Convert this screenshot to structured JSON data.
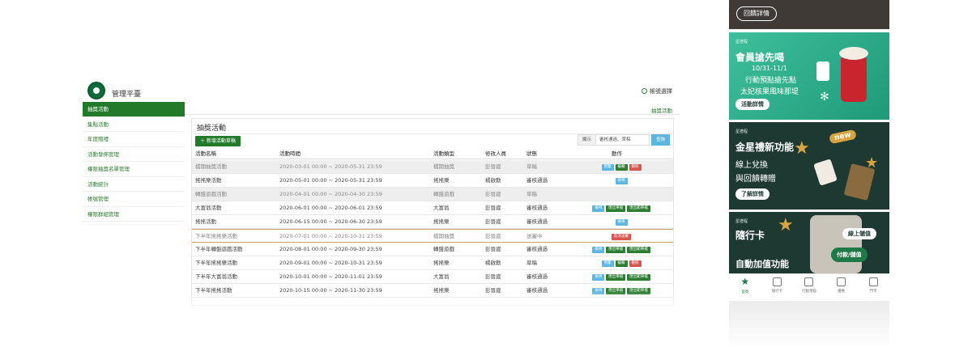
{
  "admin": {
    "brand": "管理平臺",
    "account": "帳號選擇",
    "breadcrumb": "抽獎活動",
    "sidebar": [
      "抽獎活動",
      "集點活動",
      "年度贈禮",
      "活動發佈管理",
      "權限抽獎名單管理",
      "活動統計",
      "帳號管理",
      "權限群組管理"
    ],
    "panel_title": "抽獎活動",
    "add_button": "＋ 新增活動草稿",
    "filter": {
      "label": "顯示",
      "value": "審核通過、草稿",
      "go": "查詢"
    },
    "columns": [
      "活動名稱",
      "活動時間",
      "活動類型",
      "修改人員",
      "狀態",
      "動作"
    ],
    "rows": [
      {
        "name": "檔期抽獎活動",
        "time": "2020-03-01 00:00 ~ 2020-05-31 23:59",
        "type": "檔期抽獎",
        "user": "彭晉崴",
        "state": "草稿",
        "actions": [
          [
            "預覽",
            "blue"
          ],
          [
            "編輯",
            "green"
          ],
          [
            "刪除",
            "red"
          ]
        ]
      },
      {
        "name": "搖搖樂活動",
        "time": "2020-05-01 00:00 ~ 2020-05-31 23:59",
        "type": "搖搖樂",
        "user": "楊啟勳",
        "state": "審核通過",
        "actions": [
          [
            "檢視",
            "blue"
          ]
        ]
      },
      {
        "name": "轉盤遊戲活動",
        "time": "2020-04-01 00:00 ~ 2020-04-30 23:59",
        "type": "轉盤遊戲",
        "user": "彭晉崴",
        "state": "草稿",
        "actions": []
      },
      {
        "name": "大富翁活動",
        "time": "2020-06-01 00:00 ~ 2020-06-01 23:59",
        "type": "大富翁",
        "user": "彭晉崴",
        "state": "審核通過",
        "actions": [
          [
            "檢視",
            "blue"
          ],
          [
            "匯出單檔",
            "green"
          ],
          [
            "匯出範單檔",
            "green"
          ]
        ]
      },
      {
        "name": "搖搖活動",
        "time": "2020-06-15 00:00 ~ 2020-06-30 23:59",
        "type": "搖搖樂",
        "user": "彭晉崴",
        "state": "審核通過",
        "actions": [
          [
            "檢視",
            "blue"
          ]
        ]
      },
      {
        "name": "下半年搖搖樂活動",
        "time": "2020-07-01 00:00 ~ 2020-10-31 23:59",
        "type": "檔期抽獎",
        "user": "彭晉崴",
        "state": "送審中",
        "actions": [
          [
            "取消送審",
            "red"
          ]
        ]
      },
      {
        "name": "下半年轉盤遊戲活動",
        "time": "2020-08-01 00:00 ~ 2020-09-30 23:59",
        "type": "轉盤遊戲",
        "user": "彭晉崴",
        "state": "審核通過",
        "actions": [
          [
            "檢視",
            "blue"
          ],
          [
            "匯出單檔",
            "green"
          ],
          [
            "匯出範單檔",
            "green"
          ]
        ]
      },
      {
        "name": "下半年搖搖樂活動",
        "time": "2020-09-01 00:00 ~ 2020-10-31 23:59",
        "type": "搖搖樂",
        "user": "楊啟勳",
        "state": "草稿",
        "actions": [
          [
            "預覽",
            "blue"
          ],
          [
            "編輯",
            "green"
          ],
          [
            "刪除",
            "red"
          ]
        ]
      },
      {
        "name": "下半年大富翁活動",
        "time": "2020-10-01 00:00 ~ 2020-11-01 23:59",
        "type": "大富翁",
        "user": "彭晉崴",
        "state": "審核通過",
        "actions": [
          [
            "檢視",
            "blue"
          ],
          [
            "匯出單檔",
            "green"
          ],
          [
            "匯出範單檔",
            "green"
          ]
        ]
      },
      {
        "name": "下半年搖搖活動",
        "time": "2020-10-15 00:00 ~ 2020-11-30 23:59",
        "type": "搖搖樂",
        "user": "彭晉崴",
        "state": "審核通過",
        "actions": [
          [
            "檢視",
            "blue"
          ],
          [
            "匯出單檔",
            "green"
          ],
          [
            "匯出範單檔",
            "green"
          ]
        ]
      }
    ]
  },
  "mobile": {
    "top_button": "回饋詳情",
    "card1": {
      "kicker": "星禮程",
      "title": "會員搶先喝",
      "dates": "10/31-11/1",
      "line1": "行動預點搶先點",
      "line2": "太妃核果風味那堤",
      "button": "活動詳情"
    },
    "card2": {
      "kicker": "星禮程",
      "title": "金星禮新功能",
      "line1": "線上兌換",
      "line2": "與回饋轉贈",
      "button": "了解詳情",
      "badge": "new"
    },
    "card3": {
      "kicker": "星禮程",
      "title": "隨行卡",
      "line1": "自動加值功能",
      "btn_a": "線上儲值",
      "btn_b": "付款/儲值"
    },
    "nav": [
      "首頁",
      "隨行卡",
      "行動預點",
      "優惠",
      "門市"
    ]
  },
  "colors": {
    "accent": "#237b2a",
    "brand_dark": "#1e3932",
    "teal": "#2aaa85",
    "gold": "#d7a441"
  }
}
